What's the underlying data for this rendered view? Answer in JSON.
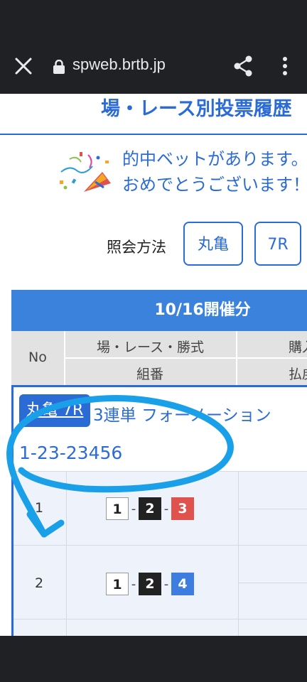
{
  "browser": {
    "url": "spweb.brtb.jp"
  },
  "page": {
    "title": "場・レース別投票履歴",
    "hit_message_line1": "的中ベットがあります。",
    "hit_message_line2": "おめでとうございます！",
    "inquiry_label": "照会方法",
    "inquiry_venue": "丸亀",
    "inquiry_race": "7R"
  },
  "table": {
    "date_header": "10/16開催分",
    "col_no": "No",
    "col_race_type": "場・レース・勝式",
    "col_combination": "組番",
    "col_purchase": "購入",
    "col_payout": "払戻",
    "entry": {
      "badge": "丸亀 7R",
      "bet_type": "3連単 フォーメーション",
      "combination": "1-23-23456"
    },
    "rows": [
      {
        "no": "1",
        "nums": [
          "1",
          "2",
          "3"
        ]
      },
      {
        "no": "2",
        "nums": [
          "1",
          "2",
          "4"
        ]
      }
    ]
  },
  "colors": {
    "accent": "#2b6bd6",
    "header_bg": "#3b82dc",
    "annotation": "#1aa0e8"
  }
}
